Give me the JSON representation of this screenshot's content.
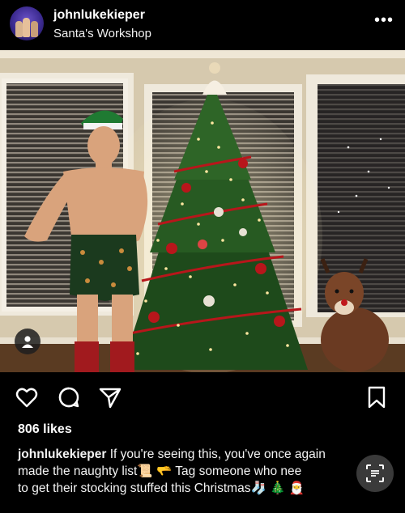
{
  "post": {
    "username": "johnlukekieper",
    "location": "Santa's Workshop",
    "more_label": "•••"
  },
  "icons": {
    "avatar": "avatar-photo",
    "more": "more-options-icon",
    "like": "heart-outline-icon",
    "comment": "comment-bubble-icon",
    "share": "paper-plane-icon",
    "save": "bookmark-outline-icon",
    "tagged_users": "person-icon",
    "text_scan": "text-scan-icon"
  },
  "engagement": {
    "likes": "806 likes"
  },
  "caption": {
    "user": "johnlukekieper",
    "line1": " If you're seeing this, you've once again",
    "line2": "made the naughty list📜 🫳 Tag someone who nee",
    "line3": "to get their stocking stuffed this Christmas🧦 🎄 🎅"
  },
  "colors": {
    "background": "#000000",
    "text": "#ffffff",
    "tree": "#1f4a1c",
    "lights": "#ffe7a0",
    "ornament_red": "#b8161b"
  }
}
